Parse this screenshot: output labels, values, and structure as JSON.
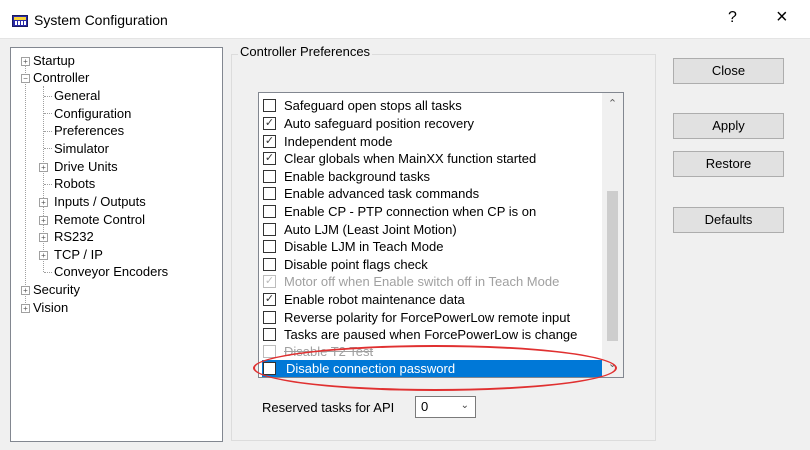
{
  "window": {
    "title": "System Configuration",
    "help": "?",
    "close": "×"
  },
  "tree": {
    "items": [
      {
        "label": "Startup",
        "expander": "+"
      },
      {
        "label": "Controller",
        "expander": "−"
      },
      {
        "label": "General"
      },
      {
        "label": "Configuration"
      },
      {
        "label": "Preferences"
      },
      {
        "label": "Simulator"
      },
      {
        "label": "Drive Units",
        "expander": "+"
      },
      {
        "label": "Robots"
      },
      {
        "label": "Inputs / Outputs",
        "expander": "+"
      },
      {
        "label": "Remote Control",
        "expander": "+"
      },
      {
        "label": "RS232",
        "expander": "+"
      },
      {
        "label": "TCP / IP",
        "expander": "+"
      },
      {
        "label": "Conveyor Encoders"
      },
      {
        "label": "Security",
        "expander": "+"
      },
      {
        "label": "Vision",
        "expander": "+"
      }
    ]
  },
  "preferences": {
    "group_title": "Controller Preferences",
    "options": [
      {
        "label": "Safeguard open stops all tasks",
        "checked": false
      },
      {
        "label": "Auto safeguard position recovery",
        "checked": true
      },
      {
        "label": "Independent mode",
        "checked": true
      },
      {
        "label": "Clear globals when MainXX function started",
        "checked": true
      },
      {
        "label": "Enable background tasks",
        "checked": false
      },
      {
        "label": "Enable advanced task commands",
        "checked": false
      },
      {
        "label": "Enable CP - PTP connection when CP is on",
        "checked": false
      },
      {
        "label": "Auto LJM (Least Joint Motion)",
        "checked": false
      },
      {
        "label": "Disable LJM in Teach Mode",
        "checked": false
      },
      {
        "label": "Disable point flags check",
        "checked": false
      },
      {
        "label": "Motor off when Enable switch off in Teach Mode",
        "checked": true,
        "disabled": true
      },
      {
        "label": "Enable robot maintenance data",
        "checked": true
      },
      {
        "label": "Reverse polarity for ForcePowerLow remote input",
        "checked": false
      },
      {
        "label": "Tasks are paused when ForcePowerLow is change",
        "checked": false
      },
      {
        "label": "Disable T2 Test",
        "checked": false,
        "disabled": true,
        "struck": true
      },
      {
        "label": "Disable connection password",
        "checked": false,
        "selected": true
      }
    ],
    "check_glyph": "✓",
    "scroll_up": "⌃",
    "scroll_down": "⌄",
    "reserved_label": "Reserved tasks for API",
    "reserved_value": "0",
    "select_arrow": "⌄"
  },
  "buttons": {
    "close": "Close",
    "apply": "Apply",
    "restore": "Restore",
    "defaults": "Defaults"
  },
  "colors": {
    "selection": "#0078d7",
    "annotation": "#e03030"
  }
}
